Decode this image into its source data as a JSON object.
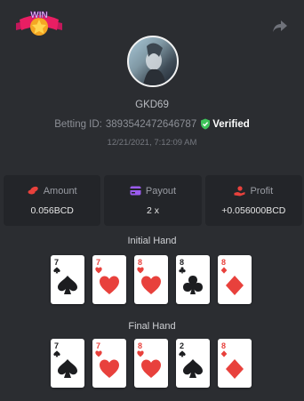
{
  "badge": {
    "text": "WIN"
  },
  "player": {
    "username": "GKD69"
  },
  "bet": {
    "label": "Betting ID:",
    "id": "3893542472646787",
    "verified_label": "Verified",
    "timestamp": "12/21/2021, 7:12:09 AM"
  },
  "stats": [
    {
      "label": "Amount",
      "value": "0.056BCD",
      "icon": "coins-icon",
      "icon_color": "#e8413c"
    },
    {
      "label": "Payout",
      "value": "2 x",
      "icon": "card-payment-icon",
      "icon_color": "#9b5cf0"
    },
    {
      "label": "Profit",
      "value": "+0.056000BCD",
      "icon": "hand-coin-icon",
      "icon_color": "#e8413c"
    }
  ],
  "initial_hand": {
    "title": "Initial Hand",
    "cards": [
      {
        "rank": "7",
        "suit": "spade",
        "color": "black"
      },
      {
        "rank": "7",
        "suit": "heart",
        "color": "red"
      },
      {
        "rank": "8",
        "suit": "heart",
        "color": "red"
      },
      {
        "rank": "8",
        "suit": "club",
        "color": "black"
      },
      {
        "rank": "8",
        "suit": "diamond",
        "color": "red"
      }
    ]
  },
  "final_hand": {
    "title": "Final Hand",
    "cards": [
      {
        "rank": "7",
        "suit": "spade",
        "color": "black"
      },
      {
        "rank": "7",
        "suit": "heart",
        "color": "red"
      },
      {
        "rank": "8",
        "suit": "heart",
        "color": "red"
      },
      {
        "rank": "2",
        "suit": "spade",
        "color": "black"
      },
      {
        "rank": "8",
        "suit": "diamond",
        "color": "red"
      }
    ]
  },
  "colors": {
    "background": "#2b2d31",
    "panel": "#232529",
    "verified_green": "#3ec45a",
    "red_suit": "#e8413c"
  }
}
